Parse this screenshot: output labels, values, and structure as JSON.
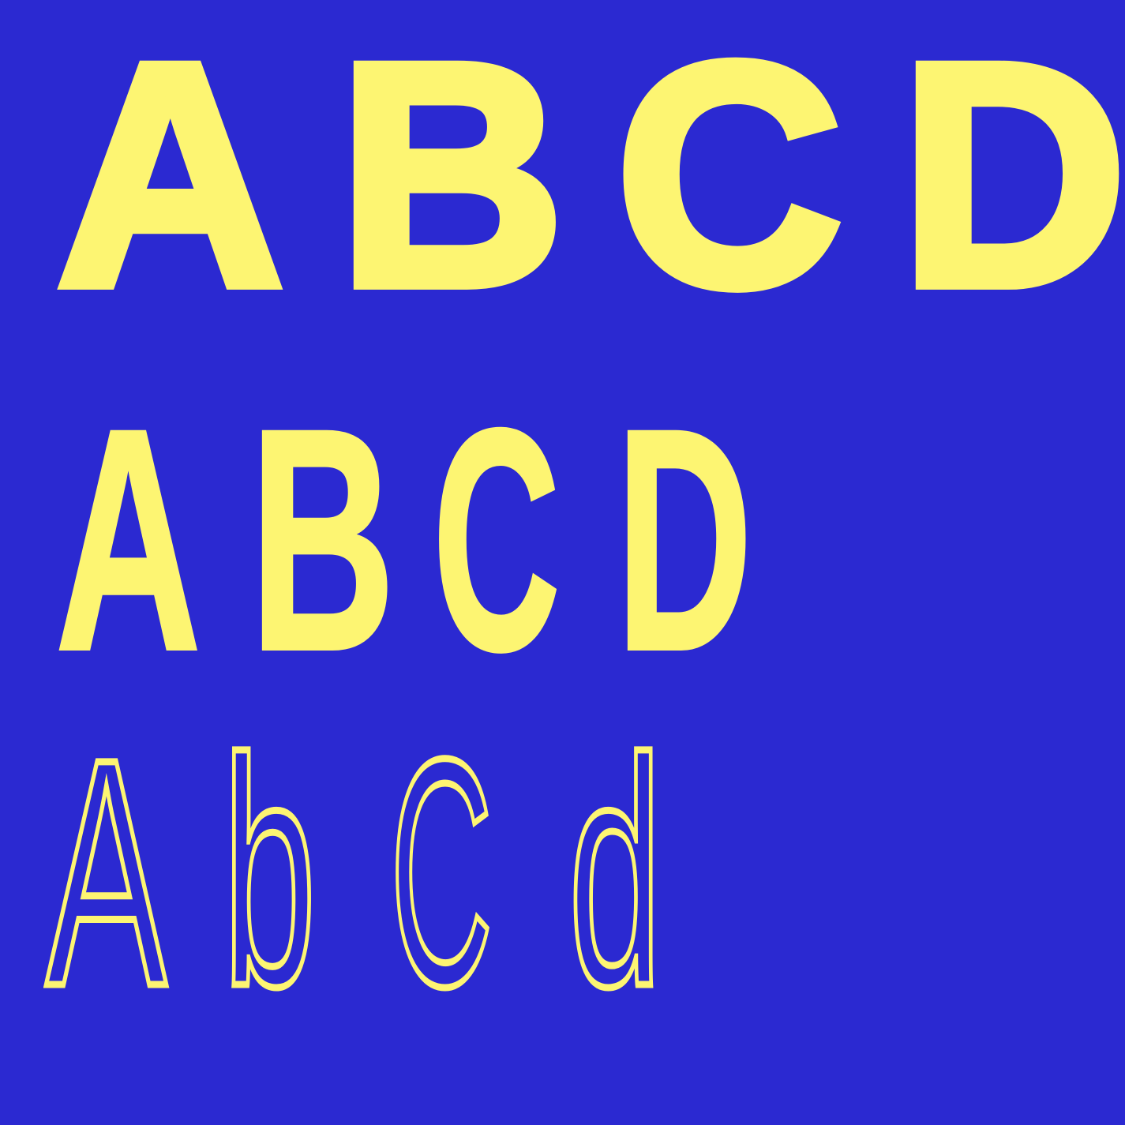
{
  "rows": [
    {
      "style": "extra-bold wide",
      "letters": [
        "A",
        "B",
        "C",
        "D"
      ]
    },
    {
      "style": "bold condensed",
      "letters": [
        "A",
        "B",
        "C",
        "D"
      ]
    },
    {
      "style": "thin condensed",
      "letters": [
        "A",
        "b",
        "C",
        "d"
      ]
    }
  ],
  "colors": {
    "background": "#2b29d1",
    "glyph": "#fdf572"
  }
}
